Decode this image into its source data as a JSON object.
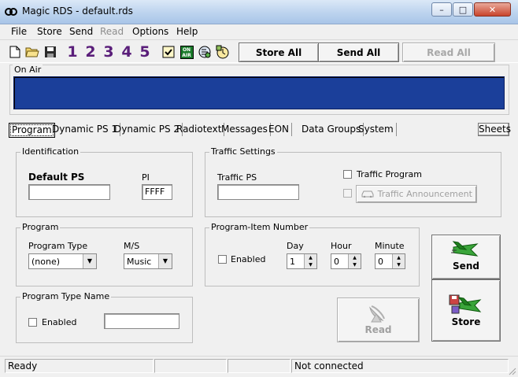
{
  "window": {
    "title": "Magic RDS - default.rds",
    "logo_icon": "magic-rds-logo-icon",
    "minimize_icon": "minimize-icon",
    "maximize_icon": "maximize-icon",
    "close_icon": "close-icon"
  },
  "menu": [
    {
      "label": "File",
      "disabled": false
    },
    {
      "label": "Store",
      "disabled": false
    },
    {
      "label": "Send",
      "disabled": false
    },
    {
      "label": "Read",
      "disabled": true
    },
    {
      "label": "Options",
      "disabled": false
    },
    {
      "label": "Help",
      "disabled": false
    }
  ],
  "toolbar": {
    "icons": [
      "new-file-icon",
      "open-folder-icon",
      "save-disk-icon"
    ],
    "numbers": [
      "1",
      "2",
      "3",
      "4",
      "5"
    ],
    "extra_icons": [
      "checklist-icon",
      "on-air-icon",
      "rds-settings-icon",
      "clock-icon"
    ],
    "on_air_icon_text": "ON AIR",
    "store_all": "Store All",
    "send_all": "Send All",
    "read_all": "Read All"
  },
  "on_air": {
    "label": "On Air",
    "text": ""
  },
  "tabs": [
    "Program",
    "Dynamic PS 1",
    "Dynamic PS 2",
    "Radiotext",
    "Messages",
    "EON",
    "Data Groups",
    "System"
  ],
  "active_tab": "Program",
  "sheets": "Sheets",
  "identification": {
    "title": "Identification",
    "default_ps_label": "Default PS",
    "default_ps_value": "",
    "pi_label": "PI",
    "pi_value": "FFFF"
  },
  "traffic": {
    "title": "Traffic Settings",
    "traffic_ps_label": "Traffic PS",
    "traffic_ps_value": "",
    "traffic_program_label": "Traffic Program",
    "traffic_program_checked": false,
    "traffic_announcement_label": "Traffic Announcement",
    "traffic_announcement_checked": false,
    "car_icon": "car-icon"
  },
  "program": {
    "title": "Program",
    "program_type_label": "Program Type",
    "program_type_value": "(none)",
    "ms_label": "M/S",
    "ms_value": "Music"
  },
  "program_item": {
    "title": "Program-Item Number",
    "enabled_label": "Enabled",
    "enabled_checked": false,
    "day_label": "Day",
    "day_value": "1",
    "hour_label": "Hour",
    "hour_value": "0",
    "minute_label": "Minute",
    "minute_value": "0"
  },
  "program_type_name": {
    "title": "Program Type Name",
    "enabled_label": "Enabled",
    "enabled_checked": false,
    "value": ""
  },
  "actions": {
    "read": "Read",
    "read_icon": "satellite-dish-icon",
    "send": "Send",
    "send_icon": "jet-send-icon",
    "store": "Store",
    "store_icon": "jet-store-icon"
  },
  "status": {
    "left": "Ready",
    "mid1": "",
    "mid2": "",
    "connection": "Not connected"
  }
}
